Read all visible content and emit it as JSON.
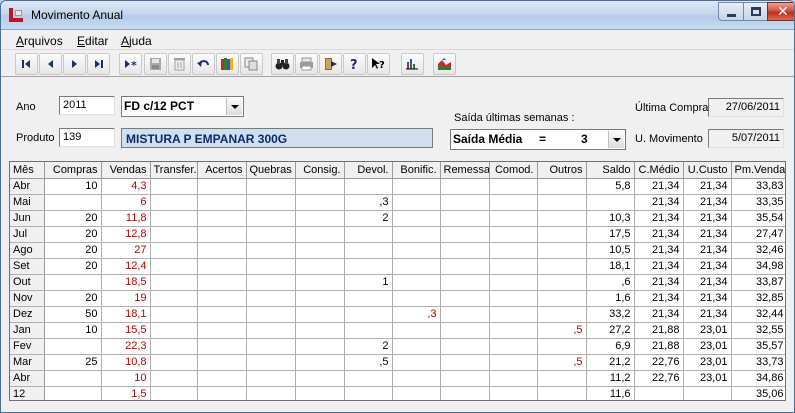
{
  "window": {
    "title": "Movimento Anual"
  },
  "menu": [
    {
      "label": "Arquivos",
      "accel": "A",
      "rest": "rquivos"
    },
    {
      "label": "Editar",
      "accel": "E",
      "rest": "ditar"
    },
    {
      "label": "Ajuda",
      "accel": "A",
      "rest": "juda"
    }
  ],
  "toolbar": [
    "first-record-icon",
    "prev-record-icon",
    "next-record-icon",
    "last-record-icon",
    "new-record-icon",
    "save-icon",
    "delete-icon",
    "undo-icon",
    "books-icon",
    "copy-icon",
    "binoculars-icon",
    "print-icon",
    "exit-icon",
    "help-icon",
    "whats-this-icon",
    "bar-chart-icon",
    "area-chart-icon"
  ],
  "form": {
    "ano_label": "Ano",
    "ano_value": "2011",
    "produto_label": "Produto",
    "produto_code": "139",
    "produto_name": "MISTURA P EMPANAR 300G",
    "unit_selected": "FD  c/12 PCT",
    "saida_label": "Saída últimas semanas :",
    "saida_selected_label": "Saída Média",
    "saida_selected_eq": "=",
    "saida_selected_value": "3",
    "ultima_compra_label": "Última Compra",
    "ultima_compra_value": "27/06/2011",
    "u_movimento_label": "U. Movimento",
    "u_movimento_value": "5/07/2011"
  },
  "colors": {
    "red_text": "#c00000",
    "product_bg": "#cfdff0"
  },
  "table": {
    "headers": [
      "Mês",
      "Compras",
      "Vendas",
      "Transfer.",
      "Acertos",
      "Quebras",
      "Consig.",
      "Devol.",
      "Bonific.",
      "Remessa",
      "Comod.",
      "Outros",
      "Saldo",
      "C.Médio",
      "U.Custo",
      "Pm.Venda"
    ],
    "rows": [
      [
        "Abr",
        "10",
        "4,3",
        "",
        "",
        "",
        "",
        "",
        "",
        "",
        "",
        "",
        "5,8",
        "21,34",
        "21,34",
        "33,83"
      ],
      [
        "Mai",
        "",
        "6",
        "",
        "",
        "",
        "",
        ",3",
        "",
        "",
        "",
        "",
        "",
        "21,34",
        "21,34",
        "33,35"
      ],
      [
        "Jun",
        "20",
        "11,8",
        "",
        "",
        "",
        "",
        "2",
        "",
        "",
        "",
        "",
        "10,3",
        "21,34",
        "21,34",
        "35,54"
      ],
      [
        "Jul",
        "20",
        "12,8",
        "",
        "",
        "",
        "",
        "",
        "",
        "",
        "",
        "",
        "17,5",
        "21,34",
        "21,34",
        "27,47"
      ],
      [
        "Ago",
        "20",
        "27",
        "",
        "",
        "",
        "",
        "",
        "",
        "",
        "",
        "",
        "10,5",
        "21,34",
        "21,34",
        "32,46"
      ],
      [
        "Set",
        "20",
        "12,4",
        "",
        "",
        "",
        "",
        "",
        "",
        "",
        "",
        "",
        "18,1",
        "21,34",
        "21,34",
        "34,98"
      ],
      [
        "Out",
        "",
        "18,5",
        "",
        "",
        "",
        "",
        "1",
        "",
        "",
        "",
        "",
        ",6",
        "21,34",
        "21,34",
        "33,87"
      ],
      [
        "Nov",
        "20",
        "19",
        "",
        "",
        "",
        "",
        "",
        "",
        "",
        "",
        "",
        "1,6",
        "21,34",
        "21,34",
        "32,85"
      ],
      [
        "Dez",
        "50",
        "18,1",
        "",
        "",
        "",
        "",
        "",
        ",3",
        "",
        "",
        "",
        "33,2",
        "21,34",
        "21,34",
        "32,44"
      ],
      [
        "Jan",
        "10",
        "15,5",
        "",
        "",
        "",
        "",
        "",
        "",
        "",
        "",
        ",5",
        "27,2",
        "21,88",
        "23,01",
        "32,55"
      ],
      [
        "Fev",
        "",
        "22,3",
        "",
        "",
        "",
        "",
        "2",
        "",
        "",
        "",
        "",
        "6,9",
        "21,88",
        "23,01",
        "35,57"
      ],
      [
        "Mar",
        "25",
        "10,8",
        "",
        "",
        "",
        "",
        ",5",
        "",
        "",
        "",
        ",5",
        "21,2",
        "22,76",
        "23,01",
        "33,73"
      ],
      [
        "Abr",
        "",
        "10",
        "",
        "",
        "",
        "",
        "",
        "",
        "",
        "",
        "",
        "11,2",
        "22,76",
        "23,01",
        "34,86"
      ],
      [
        "12",
        "",
        "1,5",
        "",
        "",
        "",
        "",
        "",
        "",
        "",
        "",
        "",
        "11,6",
        "",
        "",
        "35,06"
      ]
    ]
  }
}
